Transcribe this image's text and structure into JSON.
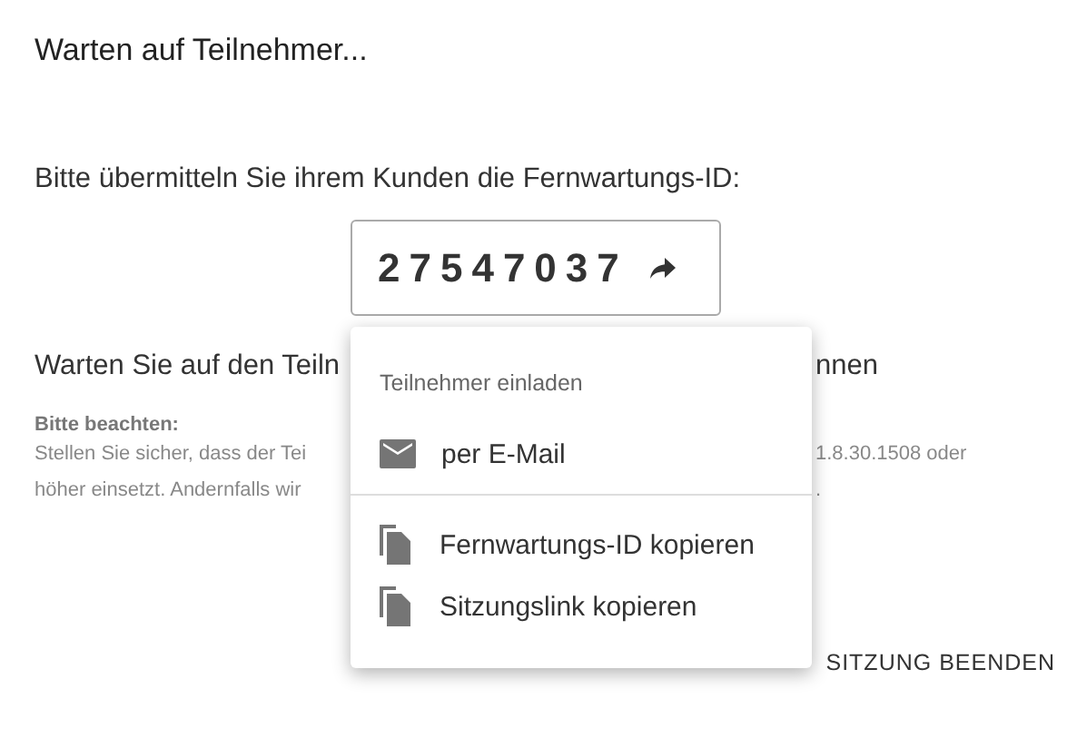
{
  "dialog": {
    "title": "Warten auf Teilnehmer...",
    "instruction": "Bitte übermitteln Sie ihrem Kunden die Fernwartungs-ID:",
    "session_id": "27547037",
    "waiting_text": {
      "left": "Warten Sie auf den Teiln",
      "right": "nnen"
    },
    "note": {
      "heading": "Bitte beachten:",
      "lines": [
        {
          "left": "Stellen Sie sicher, dass der Tei",
          "right": "1.8.30.1508 oder"
        },
        {
          "left": "höher einsetzt. Andernfalls wir",
          "right": "."
        }
      ]
    },
    "end_button": "SITZUNG BEENDEN"
  },
  "menu": {
    "heading": "Teilnehmer einladen",
    "groups": [
      [
        {
          "kind": "mail",
          "label": "per E-Mail"
        }
      ],
      [
        {
          "kind": "copy",
          "label": "Fernwartungs-ID kopieren"
        },
        {
          "kind": "copy",
          "label": "Sitzungslink kopieren"
        }
      ]
    ]
  }
}
